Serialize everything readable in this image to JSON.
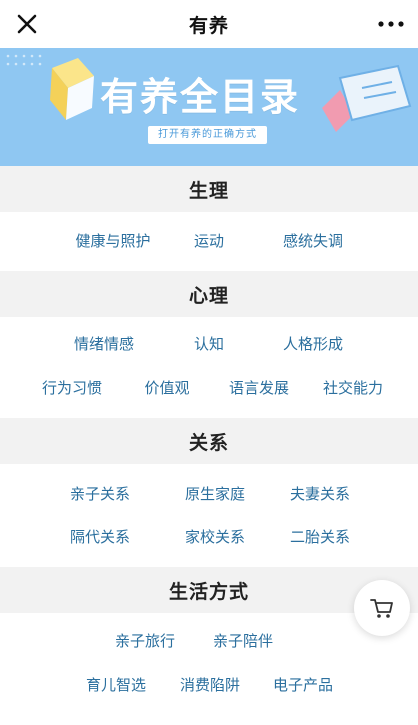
{
  "nav": {
    "title": "有养"
  },
  "banner": {
    "title_main": "有养",
    "title_accent": "全目录",
    "subtitle": "打开有养的正确方式"
  },
  "sections": [
    {
      "title": "生理",
      "tags": [
        "健康与照护",
        "运动",
        "感统失调"
      ]
    },
    {
      "title": "心理",
      "tags": [
        "情绪情感",
        "认知",
        "人格形成",
        "行为习惯",
        "价值观",
        "语言发展",
        "社交能力"
      ]
    },
    {
      "title": "关系",
      "tags": [
        "亲子关系",
        "原生家庭",
        "夫妻关系",
        "隔代关系",
        "家校关系",
        "二胎关系"
      ]
    },
    {
      "title": "生活方式",
      "tags": [
        "亲子旅行",
        "亲子陪伴",
        "育儿智选",
        "消费陷阱",
        "电子产品"
      ]
    }
  ],
  "colors": {
    "banner_bg": "#8fc7f2",
    "tag_text": "#2b6f9e",
    "section_bg": "#f2f2f2"
  },
  "icons": {
    "close": "close-icon",
    "more": "more-icon",
    "cart": "cart-icon"
  }
}
